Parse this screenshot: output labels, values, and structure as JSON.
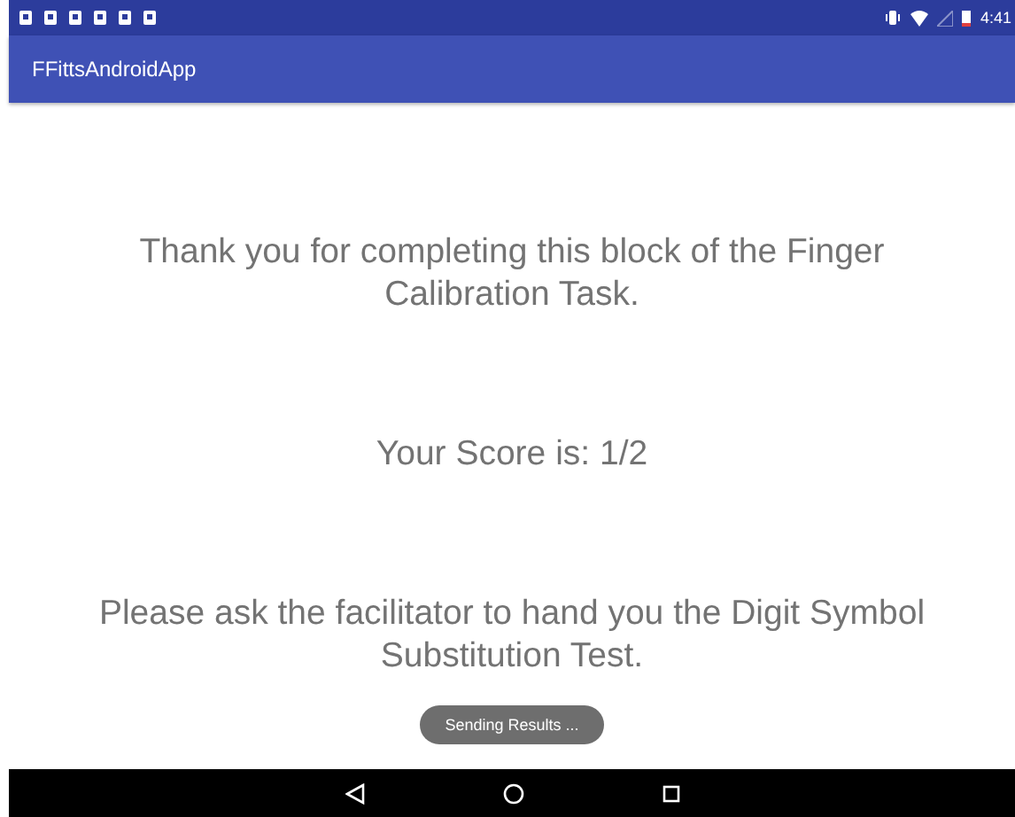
{
  "status_bar": {
    "time": "4:41"
  },
  "app_bar": {
    "title": "FFittsAndroidApp"
  },
  "messages": [
    "Thank you for completing this block of the Finger Calibration Task.",
    "Your Score is: 1/2",
    "Please ask the facilitator to hand you the Digit Symbol Substitution Test."
  ],
  "toast": "Sending Results ..."
}
